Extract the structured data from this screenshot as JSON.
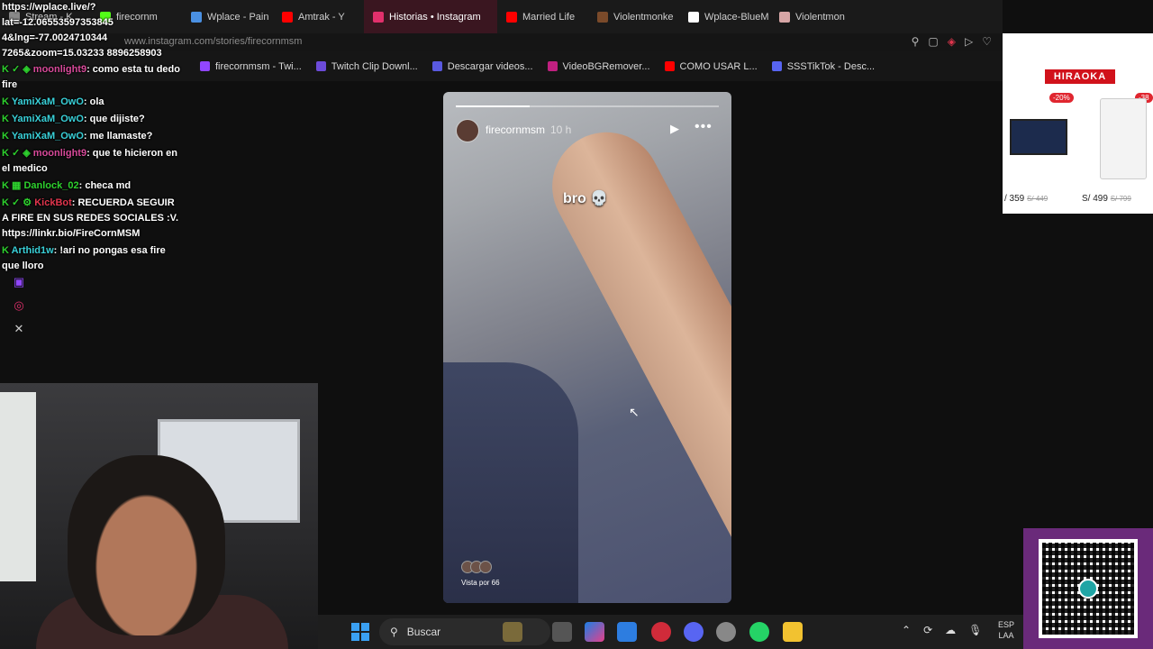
{
  "tabs": [
    {
      "label": "Stream - K",
      "color": "#888888"
    },
    {
      "label": "firecornm",
      "color": "#53fc18"
    },
    {
      "label": "Wplace - Pain",
      "color": "#4a90e2"
    },
    {
      "label": "Amtrak - Y",
      "color": "#ff0000"
    },
    {
      "label": "Historias • Instagram",
      "color": "#e1306c",
      "active": true
    },
    {
      "label": "Married Life",
      "color": "#ff0000"
    },
    {
      "label": "Violentmonke",
      "color": "#7a4a2a"
    },
    {
      "label": "Wplace-BlueM",
      "color": "#ffffff"
    },
    {
      "label": "Violentmon",
      "color": "#d7a6a6"
    }
  ],
  "address": {
    "url": "www.instagram.com/stories/firecornmsm"
  },
  "bookmarks": [
    {
      "label": "firecornmsm - Twi...",
      "color": "#9146ff"
    },
    {
      "label": "Twitch Clip Downl...",
      "color": "#6c4bd9"
    },
    {
      "label": "Descargar videos...",
      "color": "#5a5ae0"
    },
    {
      "label": "VideoBGRemover...",
      "color": "#c02080"
    },
    {
      "label": "COMO USAR L...",
      "color": "#ff0000"
    },
    {
      "label": "SSSTikTok - Desc...",
      "color": "#5865f2"
    }
  ],
  "ad": {
    "brand": "HIRAOKA",
    "discount_1": "-20%",
    "discount_2": "-38",
    "price_1": "/ 359",
    "price_1_old": "S/ 449",
    "price_2": "S/ 499",
    "price_2_old": "S/ 799"
  },
  "chat": {
    "coords": "https://wplace.live/?lat=-12.06553597353845 4&lng=-77.0024710344 7265&zoom=15.03233 8896258903",
    "messages": [
      {
        "badges": "K ✓ ◈",
        "user": "moonlight9",
        "text": ": como esta tu dedo fire"
      },
      {
        "badges": "K",
        "user": "YamiXaM_OwO",
        "text": ": ola"
      },
      {
        "badges": "K",
        "user": "YamiXaM_OwO",
        "text": ": que dijiste?"
      },
      {
        "badges": "K",
        "user": "YamiXaM_OwO",
        "text": ": me llamaste?"
      },
      {
        "badges": "K ✓ ◈",
        "user": "moonlight9",
        "text": ": que te hicieron en el medico"
      },
      {
        "badges": "K ▦",
        "user": "Danlock_02",
        "text": ": checa md"
      },
      {
        "badges": "K ✓ ⚙",
        "user": "KickBot",
        "text": ": RECUERDA SEGUIR A FIRE EN SUS REDES SOCIALES :V. https://linkr.bio/FireCornMSM"
      },
      {
        "badges": "K",
        "user": "Arthid1w",
        "text": ": !ari no pongas esa fire que lloro"
      }
    ]
  },
  "story": {
    "username": "firecornmsm",
    "age": "10 h",
    "caption": "bro 💀",
    "views": "Vista por 66",
    "progress": 0.28
  },
  "taskbar": {
    "search_placeholder": "Buscar",
    "lang_1": "ESP",
    "lang_2": "LAA"
  },
  "colors": {
    "accent": "#e1306c",
    "kick_green": "#53fc18",
    "qr_bg": "#6a2a7a"
  }
}
